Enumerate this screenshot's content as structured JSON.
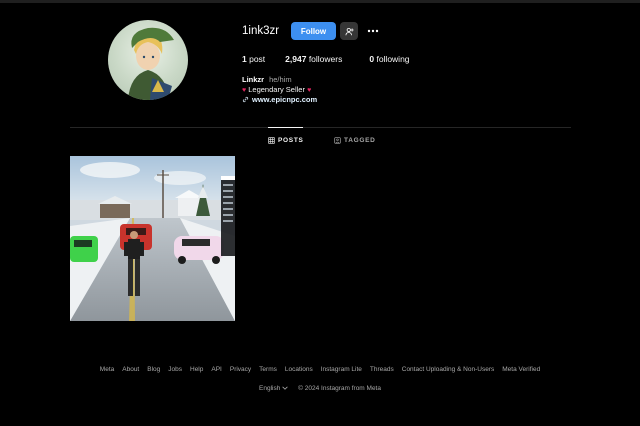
{
  "profile": {
    "username": "1ink3zr",
    "follow_label": "Follow",
    "stats": {
      "posts_count": "1",
      "posts_label": " post",
      "followers_count": "2,947",
      "followers_label": " followers",
      "following_count": "0",
      "following_label": " following"
    },
    "full_name": "Linkzr",
    "pronouns": "he/him",
    "bio_line": "Legendary Seller",
    "bio_emoji": "♥",
    "link": "www.epicnpc.com"
  },
  "tabs": [
    {
      "label": "POSTS",
      "active": true
    },
    {
      "label": "TAGGED",
      "active": false
    }
  ],
  "icons": {
    "suggest": "person-add-icon",
    "more": "more-horizontal-icon",
    "link": "link-icon",
    "posts_tab": "grid-icon",
    "tagged_tab": "tagged-icon"
  },
  "footer": {
    "links": [
      "Meta",
      "About",
      "Blog",
      "Jobs",
      "Help",
      "API",
      "Privacy",
      "Terms",
      "Locations",
      "Instagram Lite",
      "Threads",
      "Contact Uploading & Non-Users",
      "Meta Verified"
    ],
    "language": "English",
    "copyright": "© 2024 Instagram from Meta"
  },
  "colors": {
    "background": "#000000",
    "follow_button": "#3d8ff0",
    "secondary_button": "#363636",
    "muted_text": "#a8a8a8",
    "divider": "#262626"
  }
}
